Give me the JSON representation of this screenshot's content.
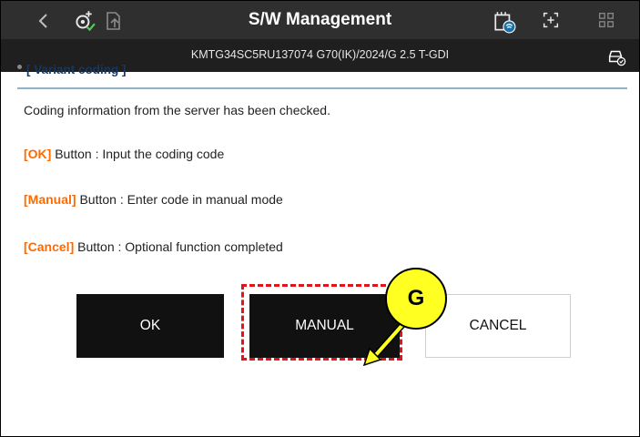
{
  "header": {
    "title": "S/W Management",
    "vin_line": "KMTG34SC5RU137074  G70(IK)/2024/G 2.5 T-GDI"
  },
  "section": {
    "title": "[ Variant coding ]",
    "message": "Coding information from the server has been checked.",
    "lines": [
      {
        "key": "[OK]",
        "text": " Button : Input the coding code"
      },
      {
        "key": "[Manual]",
        "text": " Button : Enter code in manual mode"
      },
      {
        "key": "[Cancel]",
        "text": " Button : Optional function completed"
      }
    ]
  },
  "buttons": {
    "ok": "OK",
    "manual": "MANUAL",
    "cancel": "CANCEL"
  },
  "callout": {
    "label": "G"
  },
  "colors": {
    "header_bg": "#2f2f2f",
    "vinbar_bg": "#1f1f1f",
    "accent_orange": "#ff6a00",
    "section_title": "#17375e",
    "highlight_red": "#e3121b",
    "callout_yellow": "#ffff22"
  },
  "icons": [
    "back-icon",
    "coding-config-icon",
    "document-export-icon",
    "ecu-wireless-icon",
    "expand-icon",
    "grid-icon",
    "car-status-icon"
  ]
}
